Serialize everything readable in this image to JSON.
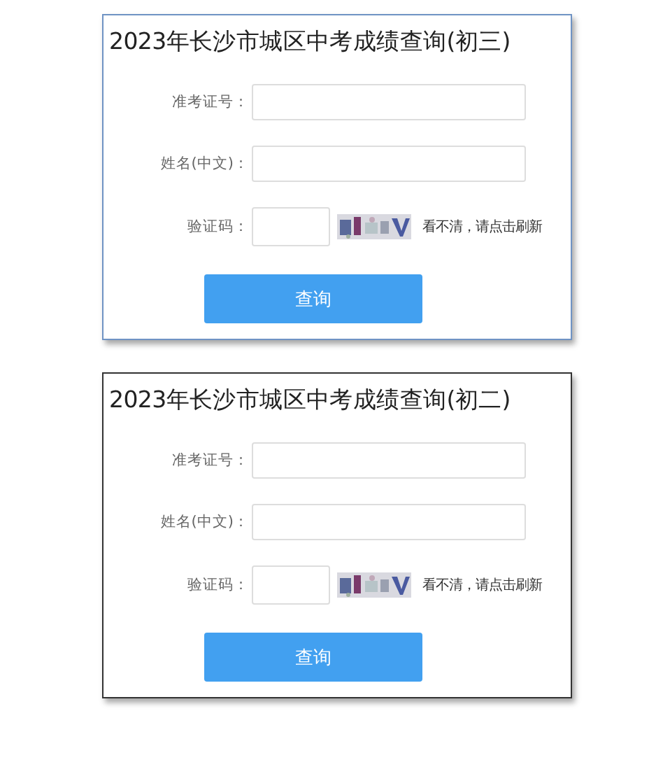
{
  "cards": [
    {
      "title": "2023年长沙市城区中考成绩查询(初三)",
      "color": "#6f93c4",
      "fields": [
        {
          "label": "准考证号："
        },
        {
          "label": "姓名(中文)："
        }
      ],
      "captcha": {
        "label": "验证码：",
        "hint": "看不清，请点击刷新"
      },
      "button": "查询"
    },
    {
      "title": "2023年长沙市城区中考成绩查询(初二)",
      "color": "#333333",
      "fields": [
        {
          "label": "准考证号："
        },
        {
          "label": "姓名(中文)："
        }
      ],
      "captcha": {
        "label": "验证码：",
        "hint": "看不清，请点击刷新"
      },
      "button": "查询"
    }
  ]
}
